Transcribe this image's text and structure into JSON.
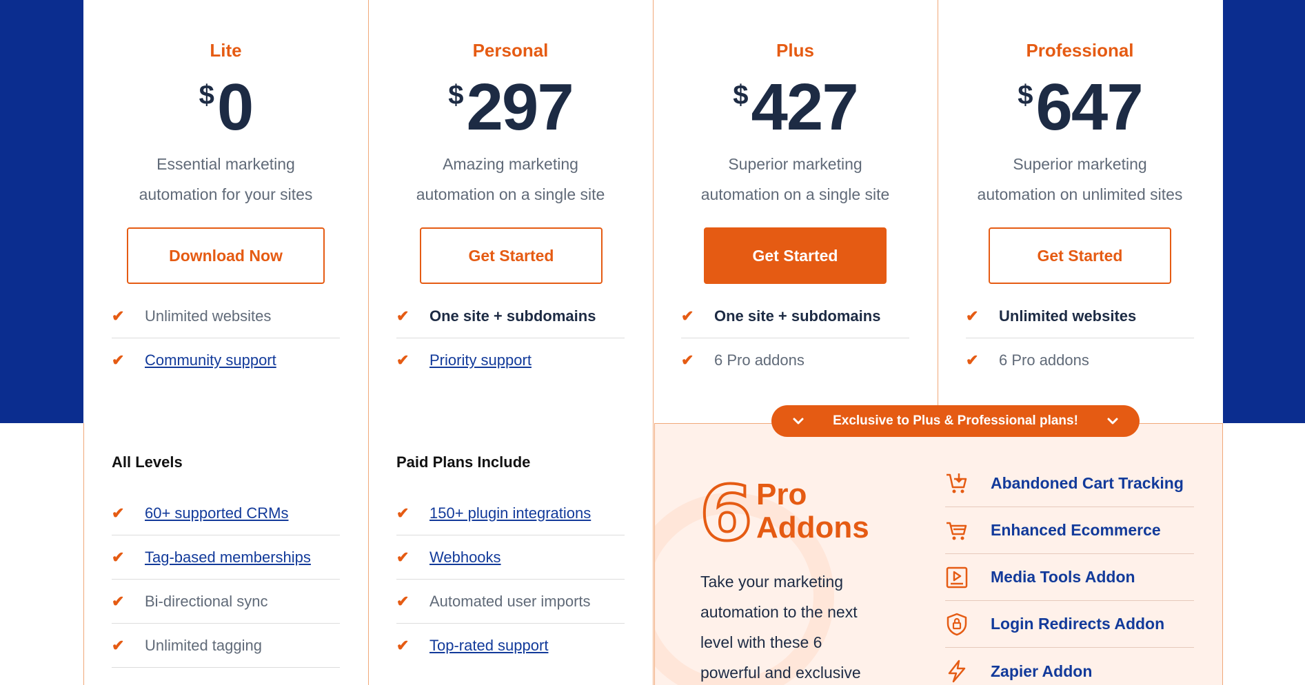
{
  "plans": [
    {
      "name": "Lite",
      "currency": "$",
      "price": "0",
      "desc_line1": "Essential marketing",
      "desc_line2": "automation for your sites",
      "button": "Download Now",
      "features": [
        {
          "text": "Unlimited websites"
        },
        {
          "text": "Community support"
        }
      ]
    },
    {
      "name": "Personal",
      "currency": "$",
      "price": "297",
      "desc_line1": "Amazing marketing",
      "desc_line2": "automation on a single site",
      "button": "Get Started",
      "features": [
        {
          "text": "One site + subdomains"
        },
        {
          "text": "Priority support"
        }
      ]
    },
    {
      "name": "Plus",
      "currency": "$",
      "price": "427",
      "desc_line1": "Superior marketing",
      "desc_line2": "automation on a single site",
      "button": "Get Started",
      "features": [
        {
          "text": "One site + subdomains"
        },
        {
          "text": "6 Pro addons"
        }
      ]
    },
    {
      "name": "Professional",
      "currency": "$",
      "price": "647",
      "desc_line1": "Superior marketing",
      "desc_line2": "automation on unlimited sites",
      "button": "Get Started",
      "features": [
        {
          "text": "Unlimited websites"
        },
        {
          "text": "6 Pro addons"
        }
      ]
    }
  ],
  "all_levels": {
    "title": "All Levels",
    "items": [
      "60+ supported CRMs",
      "Tag-based memberships",
      "Bi-directional sync",
      "Unlimited tagging"
    ]
  },
  "paid_plans": {
    "title": "Paid Plans Include",
    "items": [
      "150+ plugin integrations",
      "Webhooks",
      "Automated user imports",
      "Top-rated support"
    ]
  },
  "exclusive_banner": "Exclusive to Plus & Professional plans!",
  "addons": {
    "count": "6",
    "title_line1": "Pro",
    "title_line2": "Addons",
    "description": "Take your marketing automation to the next level with these 6 powerful and exclusive",
    "items": [
      {
        "label": "Abandoned Cart Tracking",
        "icon": "cart-download-icon"
      },
      {
        "label": "Enhanced Ecommerce",
        "icon": "cart-icon"
      },
      {
        "label": "Media Tools Addon",
        "icon": "media-play-icon"
      },
      {
        "label": "Login Redirects Addon",
        "icon": "shield-lock-icon"
      },
      {
        "label": "Zapier Addon",
        "icon": "lightning-icon"
      }
    ]
  },
  "colors": {
    "accent": "#e55b13",
    "navy": "#0b2d8f",
    "link": "#123a9a",
    "heading": "#1d2b44",
    "panel_bg": "#fff1ea"
  }
}
